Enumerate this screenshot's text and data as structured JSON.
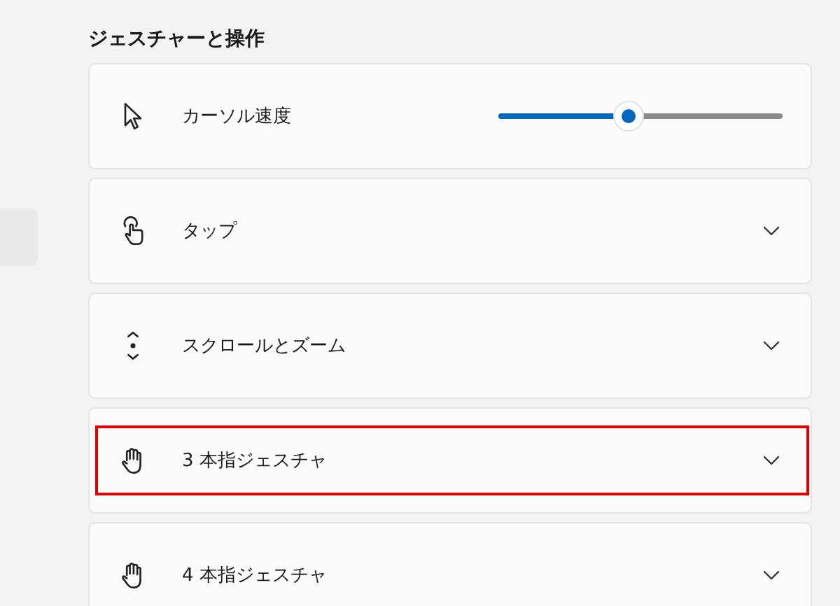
{
  "section": {
    "title": "ジェスチャーと操作"
  },
  "items": [
    {
      "kind": "slider",
      "label": "カーソル速度",
      "level": 0.46
    },
    {
      "kind": "expander",
      "label": "タップ",
      "highlighted": false
    },
    {
      "kind": "expander",
      "label": "スクロールとズーム",
      "highlighted": false
    },
    {
      "kind": "expander",
      "label": "3 本指ジェスチャ",
      "highlighted": true
    },
    {
      "kind": "expander",
      "label": "4 本指ジェスチャ",
      "highlighted": false
    }
  ]
}
